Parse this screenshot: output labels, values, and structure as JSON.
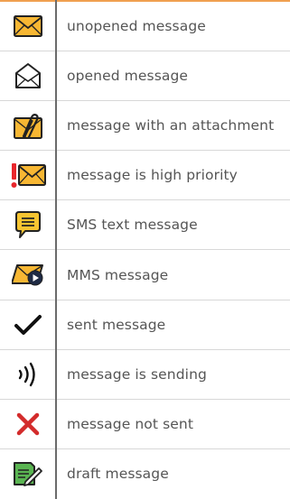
{
  "colors": {
    "accent": "#f0a050",
    "envelope": "#f7b733",
    "sms_yellow": "#f7c531",
    "priority_red": "#e8262c",
    "error_red": "#d32b2b",
    "draft_green": "#5ab552",
    "text": "#555555"
  },
  "legend": {
    "items": [
      {
        "icon": "unopened-envelope-icon",
        "label": "unopened message"
      },
      {
        "icon": "opened-envelope-icon",
        "label": "opened message"
      },
      {
        "icon": "attachment-envelope-icon",
        "label": "message with an attachment"
      },
      {
        "icon": "high-priority-envelope-icon",
        "label": "message is high priority"
      },
      {
        "icon": "sms-bubble-icon",
        "label": "SMS text message"
      },
      {
        "icon": "mms-envelope-icon",
        "label": "MMS message"
      },
      {
        "icon": "checkmark-icon",
        "label": "sent message"
      },
      {
        "icon": "sending-waves-icon",
        "label": "message is sending"
      },
      {
        "icon": "red-x-icon",
        "label": "message not sent"
      },
      {
        "icon": "draft-pencil-icon",
        "label": "draft message"
      }
    ]
  }
}
